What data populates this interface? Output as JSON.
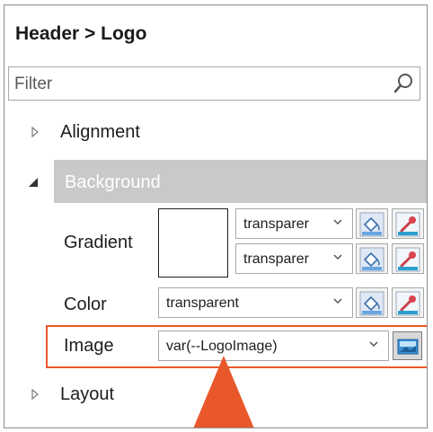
{
  "header": {
    "breadcrumb": "Header > Logo"
  },
  "filter": {
    "placeholder": "Filter"
  },
  "sections": {
    "alignment": "Alignment",
    "background": "Background",
    "layout": "Layout"
  },
  "properties": {
    "gradient": {
      "label": "Gradient",
      "color1": "transparer",
      "color2": "transparer"
    },
    "color": {
      "label": "Color",
      "value": "transparent"
    },
    "image": {
      "label": "Image",
      "value": "var(--LogoImage)"
    }
  },
  "icons": {
    "filter": "search-icon",
    "fill": "paint-bucket-icon",
    "picker": "eyedropper-icon",
    "image_browse": "image-icon",
    "dropdown": "chevron-down-icon",
    "collapsed": "triangle-right-icon",
    "expanded": "triangle-down-icon"
  },
  "colors": {
    "accent": "#e8582a",
    "section_bar": "#c9c9c9",
    "border": "#a8a8a8"
  }
}
